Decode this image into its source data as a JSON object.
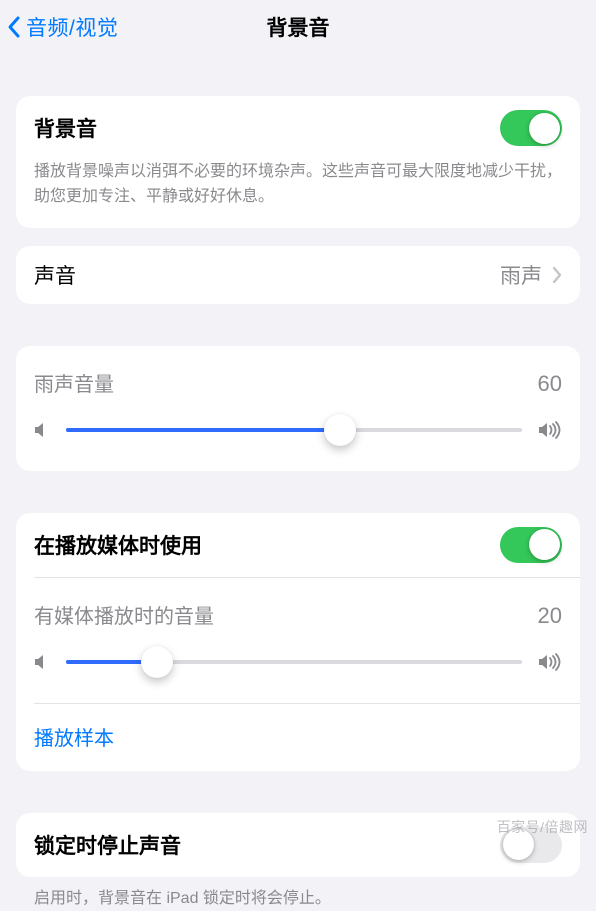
{
  "nav": {
    "back": "音频/视觉",
    "title": "背景音"
  },
  "card1": {
    "label": "背景音",
    "toggle_on": true,
    "desc": "播放背景噪声以消弭不必要的环境杂声。这些声音可最大限度地减少干扰，助您更加专注、平静或好好休息。"
  },
  "sound": {
    "label": "声音",
    "value": "雨声"
  },
  "volume": {
    "label": "雨声音量",
    "value": "60",
    "percent": 60
  },
  "media": {
    "use_label": "在播放媒体时使用",
    "use_on": true,
    "vol_label": "有媒体播放时的音量",
    "vol_value": "20",
    "vol_percent": 20,
    "sample": "播放样本"
  },
  "lock": {
    "label": "锁定时停止声音",
    "on": false,
    "desc": "启用时，背景音在 iPad 锁定时将会停止。"
  },
  "watermark": "百家号/倍趣网"
}
